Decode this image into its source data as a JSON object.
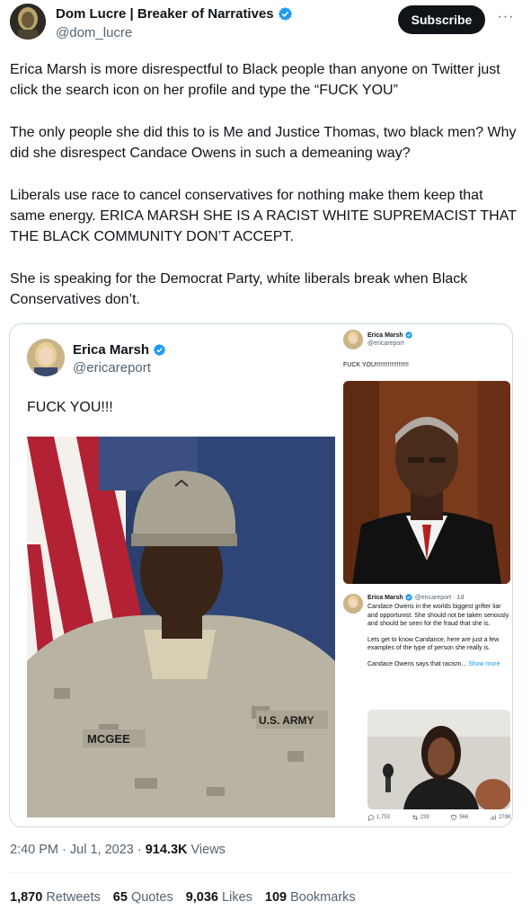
{
  "author": {
    "display_name": "Dom Lucre | Breaker of Narratives",
    "handle": "@dom_lucre",
    "verified": true,
    "avatar_icon": "avatar-icon"
  },
  "subscribe_label": "Subscribe",
  "more_label": "···",
  "tweet_paragraphs": [
    "Erica Marsh is more disrespectful to Black people than anyone on Twitter just click the search icon on her profile and type the “FUCK YOU”",
    "The only people she did this to is Me and Justice Thomas, two black men? Why did she disrespect Candace Owens in such a demeaning way?",
    "Liberals use race to cancel conservatives for nothing make them keep that same energy. ERICA MARSH SHE IS A RACIST WHITE SUPREMACIST THAT THE BLACK COMMUNITY DON’T ACCEPT.",
    "She is speaking for the Democrat Party, white liberals break when Black Conservatives don’t."
  ],
  "media": {
    "left_post": {
      "name": "Erica Marsh",
      "handle": "@ericareport",
      "text": "FUCK YOU!!!",
      "photo_labels": [
        "MCGEE",
        "U.S. ARMY"
      ]
    },
    "right_post_top": {
      "name": "Erica Marsh",
      "handle": "@ericareport",
      "text": "FUCK YOU!!!!!!!!!!!!!!!!!!!"
    },
    "right_post_bottom": {
      "name": "Erica Marsh",
      "meta": "@ericareport · 1d",
      "line1": "Candace Owens in the worlds biggest grifter liar and opportunist. She should not be taken seriously and should be seen for the fraud that she is.",
      "line2": "Lets get to know Candance, here are just a few examples of the type of person she really is.",
      "line3": "Candace Owens says that racism...",
      "show_more": "Show more",
      "stats": {
        "replies": "1,753",
        "retweets": "239",
        "likes": "566",
        "views": "278K"
      }
    }
  },
  "timestamp": {
    "time": "2:40 PM · Jul 1, 2023 · ",
    "views_num": "914.3K",
    "views_label": " Views"
  },
  "stats": {
    "retweets_num": "1,870",
    "retweets_label": "Retweets",
    "quotes_num": "65",
    "quotes_label": "Quotes",
    "likes_num": "9,036",
    "likes_label": "Likes",
    "bookmarks_num": "109",
    "bookmarks_label": "Bookmarks"
  },
  "colors": {
    "text": "#0f1419",
    "muted": "#536471",
    "verified_blue": "#1d9bf0",
    "border": "#cfd9de"
  }
}
